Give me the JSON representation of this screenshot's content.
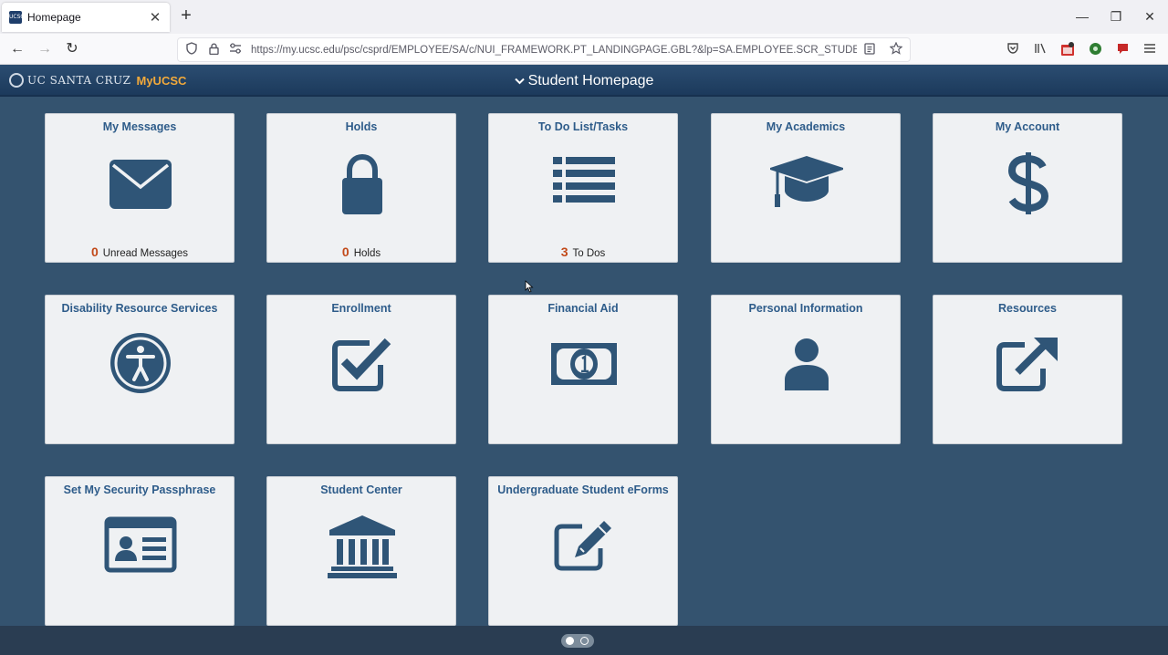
{
  "browser": {
    "tab_title": "Homepage",
    "url": "https://my.ucsc.edu/psc/csprd/EMPLOYEE/SA/c/NUI_FRAMEWORK.PT_LANDINGPAGE.GBL?&lp=SA.EMPLOYEE.SCR_STUDENT&lp=SA.",
    "favicon_text": "UCSC",
    "close_glyph": "✕",
    "newtab_glyph": "+",
    "minimize_glyph": "—",
    "restore_glyph": "❐",
    "window_close_glyph": "✕",
    "back_glyph": "←",
    "forward_glyph": "→",
    "reload_glyph": "↻"
  },
  "header": {
    "brand_uc": "UC SANTA CRUZ",
    "brand_app": "MyUCSC",
    "title": "Student Homepage",
    "chevron": "⌄"
  },
  "tiles": [
    {
      "title": "My Messages",
      "icon": "envelope-icon",
      "count": "0",
      "count_label": "Unread Messages"
    },
    {
      "title": "Holds",
      "icon": "lock-icon",
      "count": "0",
      "count_label": "Holds"
    },
    {
      "title": "To Do List/Tasks",
      "icon": "list-icon",
      "count": "3",
      "count_label": "To Dos"
    },
    {
      "title": "My Academics",
      "icon": "graduation-cap-icon"
    },
    {
      "title": "My Account",
      "icon": "dollar-icon"
    },
    {
      "title": "Disability Resource Services",
      "icon": "accessibility-icon"
    },
    {
      "title": "Enrollment",
      "icon": "checkbox-icon"
    },
    {
      "title": "Financial Aid",
      "icon": "money-icon"
    },
    {
      "title": "Personal Information",
      "icon": "person-icon"
    },
    {
      "title": "Resources",
      "icon": "external-link-icon"
    },
    {
      "title": "Set My Security Passphrase",
      "icon": "id-card-icon"
    },
    {
      "title": "Student Center",
      "icon": "institution-icon"
    },
    {
      "title": "Undergraduate Student eForms",
      "icon": "edit-icon"
    }
  ],
  "pager": {
    "pages": 2,
    "current": 1
  },
  "colors": {
    "background": "#34536f",
    "tile": "#eff1f3",
    "tile_title": "#2e5c8a",
    "icon": "#2f5577",
    "count": "#c24a1a",
    "brand_accent": "#f2a93b"
  }
}
